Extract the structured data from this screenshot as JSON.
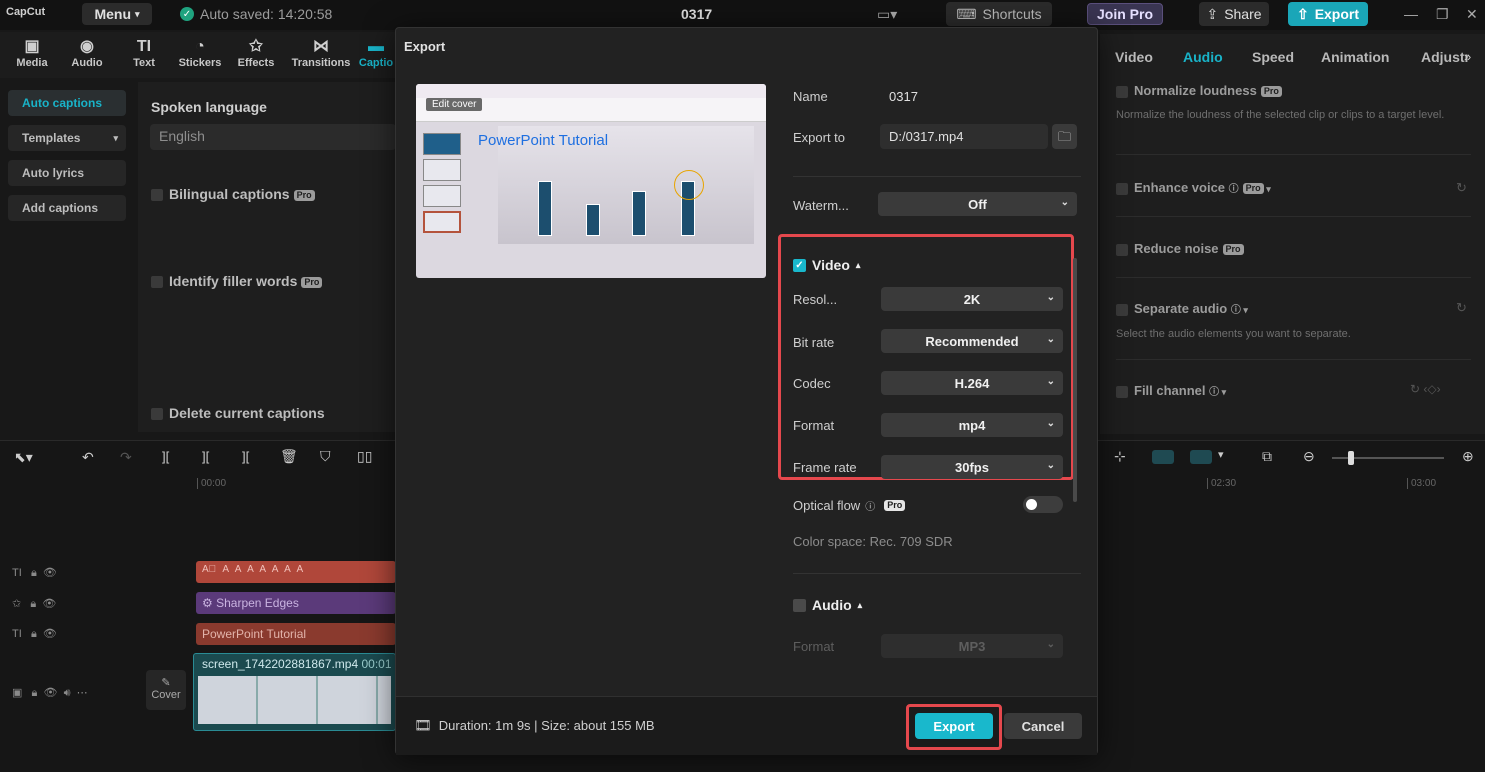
{
  "app": {
    "logo": "CapCut",
    "menu_label": "Menu",
    "autosave": "Auto saved: 14:20:58",
    "project_title": "0317",
    "shortcuts_label": "Shortcuts",
    "joinpro_label": "Join Pro",
    "share_label": "Share",
    "export_label": "Export"
  },
  "toolbar": {
    "items": [
      {
        "label": "Media",
        "icon": "media-icon"
      },
      {
        "label": "Audio",
        "icon": "audio-icon"
      },
      {
        "label": "Text",
        "icon": "text-icon"
      },
      {
        "label": "Stickers",
        "icon": "stickers-icon"
      },
      {
        "label": "Effects",
        "icon": "effects-icon"
      },
      {
        "label": "Transitions",
        "icon": "transitions-icon"
      },
      {
        "label": "Captio",
        "icon": "captions-icon"
      }
    ]
  },
  "leftnav": {
    "items": [
      "Auto captions",
      "Templates",
      "Auto lyrics",
      "Add captions"
    ]
  },
  "captions": {
    "spoken_language_label": "Spoken language",
    "language_value": "English",
    "bilingual": "Bilingual captions",
    "filler": "Identify filler words",
    "delete": "Delete current captions",
    "pro": "Pro"
  },
  "rightpanel": {
    "tabs": [
      "Video",
      "Audio",
      "Speed",
      "Animation",
      "Adjustme"
    ],
    "normalize": "Normalize loudness",
    "normalize_desc": "Normalize the loudness of the selected clip or clips to a target level.",
    "enhance": "Enhance voice",
    "reduce": "Reduce noise",
    "separate": "Separate audio",
    "separate_desc": "Select the audio elements you want to separate.",
    "fill": "Fill channel"
  },
  "timeline": {
    "time_start": "00:00",
    "time_2": "02:30",
    "time_3": "03:00",
    "effect_clip": "Sharpen Edges",
    "text_clip": "PowerPoint Tutorial",
    "video_clip": "screen_1742202881867.mp4",
    "video_clip_time": "00:01",
    "cover_label": "Cover"
  },
  "dialog": {
    "title": "Export",
    "preview_title": "PowerPoint Tutorial",
    "preview_edit": "Edit cover",
    "name_label": "Name",
    "name_value": "0317",
    "exportto_label": "Export to",
    "exportto_value": "D:/0317.mp4",
    "watermark_label": "Waterm...",
    "watermark_value": "Off",
    "video_label": "Video",
    "resolution_label": "Resol...",
    "resolution_value": "2K",
    "bitrate_label": "Bit rate",
    "bitrate_value": "Recommended",
    "codec_label": "Codec",
    "codec_value": "H.264",
    "format_label": "Format",
    "format_value": "mp4",
    "framerate_label": "Frame rate",
    "framerate_value": "30fps",
    "opticalflow_label": "Optical flow",
    "colorspace": "Color space: Rec. 709 SDR",
    "audio_label": "Audio",
    "audio_format_label": "Format",
    "audio_format_value": "MP3",
    "footer_info": "Duration: 1m 9s | Size: about 155 MB",
    "export_button": "Export",
    "cancel_button": "Cancel"
  },
  "colors": {
    "accent": "#19b8cc",
    "highlight": "#e5484d",
    "pro_badge": "#9b9b9b"
  }
}
